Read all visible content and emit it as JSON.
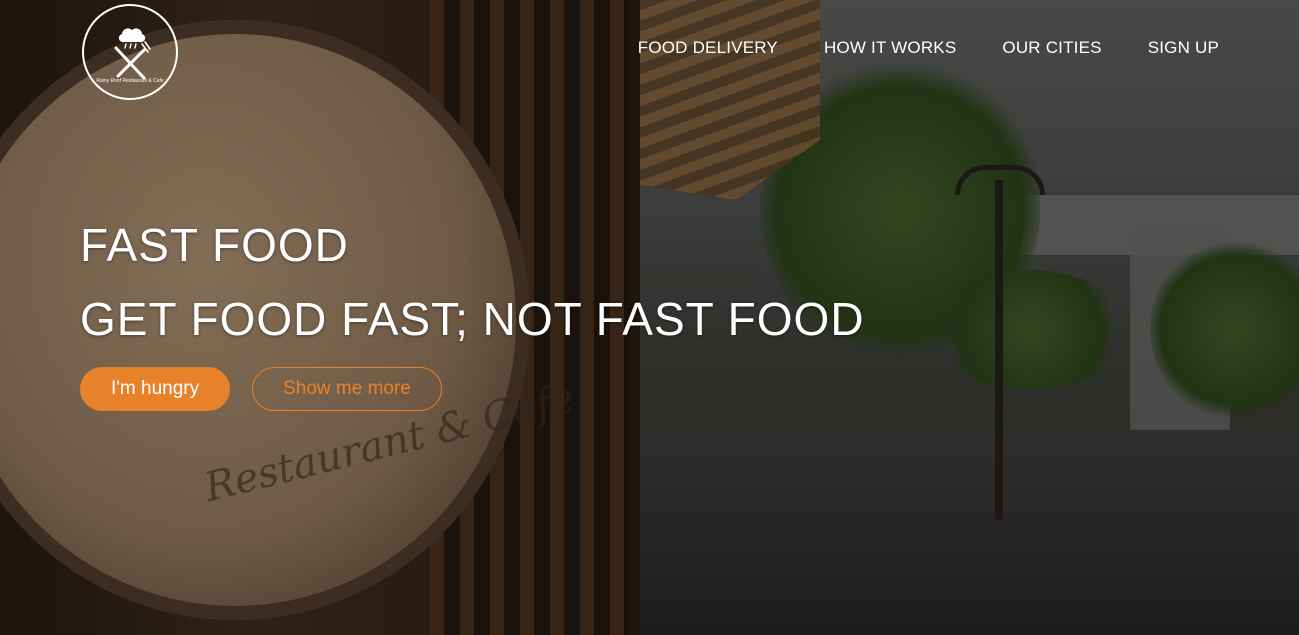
{
  "brand": {
    "logo_text": "Rainy Roof Restaurant & Cafe",
    "logo_icon": "fork-knife-cloud-icon"
  },
  "nav": {
    "items": [
      {
        "label": "FOOD DELIVERY"
      },
      {
        "label": "HOW IT WORKS"
      },
      {
        "label": "OUR CITIES"
      },
      {
        "label": "SIGN UP"
      }
    ]
  },
  "hero": {
    "title": "FAST FOOD",
    "subtitle": "GET FOOD FAST; NOT FAST FOOD",
    "primary_button": "I'm hungry",
    "secondary_button": "Show me more",
    "sign_script": "Restaurant & Cafe"
  },
  "colors": {
    "accent": "#e8822a",
    "text": "#ffffff"
  }
}
